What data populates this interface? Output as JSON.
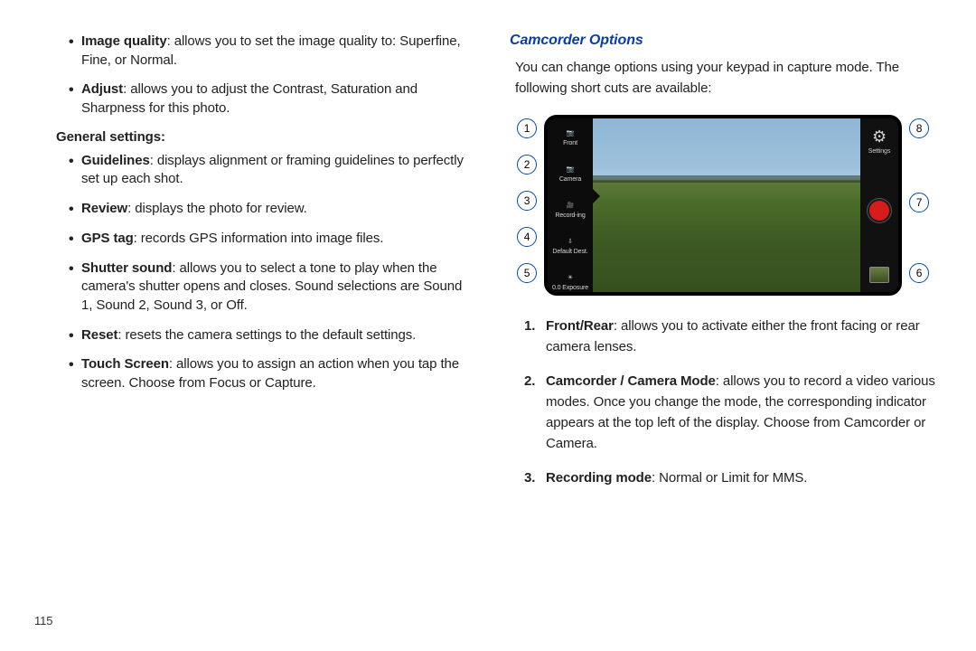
{
  "left": {
    "bullets_top": [
      {
        "term": "Image quality",
        "desc": ": allows you to set the image quality to: Superfine, Fine, or Normal."
      },
      {
        "term": "Adjust",
        "desc": ": allows you to adjust the Contrast, Saturation and Sharpness for this photo."
      }
    ],
    "general_heading": "General settings",
    "general_bullets": [
      {
        "term": "Guidelines",
        "desc": ": displays alignment or framing guidelines to perfectly set up each shot."
      },
      {
        "term": "Review",
        "desc": ": displays the photo for review."
      },
      {
        "term": "GPS tag",
        "desc": ": records GPS information into image files."
      },
      {
        "term": "Shutter sound",
        "desc": ": allows you to select a tone to play when the camera's shutter opens and closes. Sound selections are Sound 1, Sound 2, Sound 3, or Off."
      },
      {
        "term": "Reset",
        "desc": ": resets the camera settings to the default settings."
      },
      {
        "term": "Touch Screen",
        "desc": ": allows you to assign an action when you tap the screen. Choose from Focus or Capture."
      }
    ]
  },
  "right": {
    "title": "Camcorder Options",
    "intro": "You can change options using your keypad in capture mode. The following short cuts are available:",
    "left_icons": [
      {
        "glyph": "📷",
        "label": "Front"
      },
      {
        "glyph": "📷",
        "label": "Camera"
      },
      {
        "glyph": "🎥",
        "label": "Record-ing"
      },
      {
        "glyph": "⇩",
        "label": "Default Dest."
      },
      {
        "glyph": "☀",
        "label": "0.0 Exposure"
      }
    ],
    "right_labels": {
      "settings": "Settings"
    },
    "callouts": [
      "1",
      "2",
      "3",
      "4",
      "5",
      "6",
      "7",
      "8"
    ],
    "numbered": [
      {
        "term": "Front/Rear",
        "desc": ": allows you to activate either the front facing or rear camera lenses."
      },
      {
        "term": "Camcorder / Camera Mode",
        "desc": ": allows you to record a video various modes. Once you change the mode, the corresponding indicator appears at the top left of the display. Choose from Camcorder or Camera."
      },
      {
        "term": "Recording mode",
        "desc": ": Normal or Limit for MMS."
      }
    ]
  },
  "page_number": "115"
}
